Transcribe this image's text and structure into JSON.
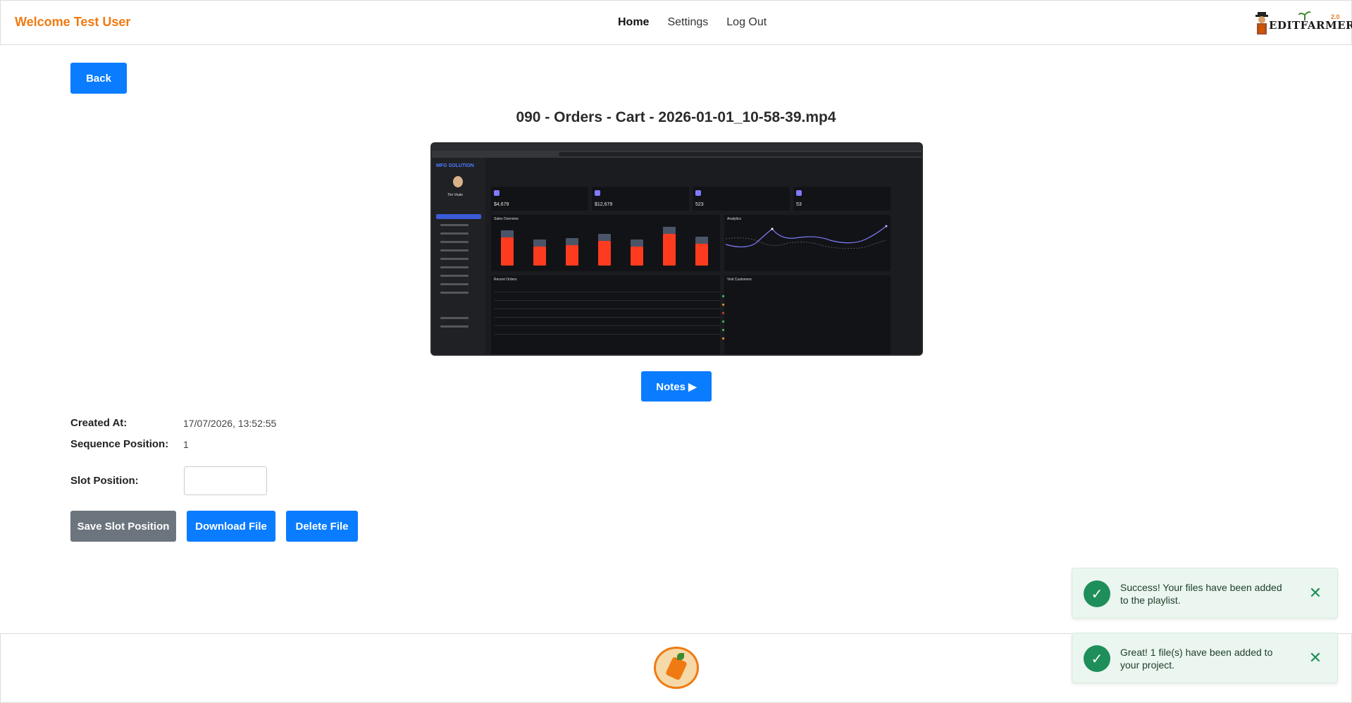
{
  "header": {
    "welcome": "Welcome Test User",
    "nav": [
      {
        "label": "Home",
        "active": true
      },
      {
        "label": "Settings",
        "active": false
      },
      {
        "label": "Log Out",
        "active": false
      }
    ],
    "logo_text": "EDITFARMER",
    "logo_version": "2.0"
  },
  "back_label": "Back",
  "file_title": "090 - Orders - Cart - 2026-01-01_10-58-39.mp4",
  "preview": {
    "brand": "MFG SOLUTION",
    "user": "Tim Veale",
    "stats": [
      "$4,679",
      "$12,679",
      "523",
      "53"
    ],
    "sales_title": "Sales Overview",
    "analytics_title": "Analytics",
    "orders_title": "Recent Orders",
    "visit_title": "Visit Customers",
    "sales_bars": [
      0.72,
      0.48,
      0.52,
      0.62,
      0.48,
      0.8,
      0.55
    ]
  },
  "notes_label": "Notes ▶",
  "details": {
    "created_label": "Created At:",
    "created_value": "17/07/2026, 13:52:55",
    "sequence_label": "Sequence Position:",
    "sequence_value": "1",
    "slot_label": "Slot Position:",
    "slot_value": ""
  },
  "actions": {
    "save": "Save Slot Position",
    "download": "Download File",
    "delete": "Delete File"
  },
  "toasts": [
    {
      "text": "Success! Your files have been added to the playlist."
    },
    {
      "text": "Great! 1 file(s) have been added to your project."
    }
  ],
  "colors": {
    "primary": "#0a7cff",
    "secondary": "#6c757d",
    "accent": "#f07a12",
    "success": "#1e8e5a"
  }
}
